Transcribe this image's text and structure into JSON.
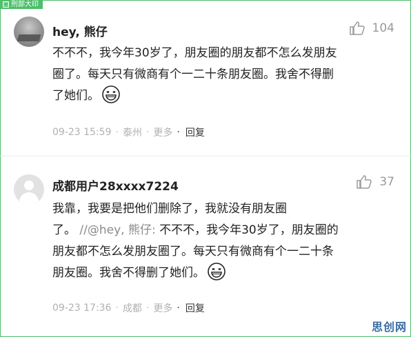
{
  "badge": {
    "label": "刑部大印",
    "icon": "stamp-icon"
  },
  "comments": [
    {
      "username": "hey, 熊仔",
      "likes": "104",
      "lines": [
        "不不不，我今年30岁了，朋友圈的朋友都不怎么发朋友",
        "圈了。每天只有微商有个一二十条朋友圈。我舍不得删",
        "了她们。"
      ],
      "time": "09-23 15:59",
      "location": "泰州",
      "more": "更多",
      "reply": "回复"
    },
    {
      "username": "成都用户28xxxx7224",
      "likes": "37",
      "line1": "我靠，我要是把他们删除了，我就没有朋友圈",
      "line2_plain": "了。",
      "quote_prefix": "//@hey, 熊仔:",
      "line2_rest": "不不不，我今年30岁了，朋友圈的",
      "line3": "朋友都不怎么发朋友圈了。每天只有微商有个一二十条",
      "line4": "朋友圈。我舍不得删了她们。",
      "time": "09-23 17:36",
      "location": "成都",
      "more": "更多",
      "reply": "回复"
    }
  ],
  "watermark": "思创网",
  "colors": {
    "frame": "#4dbf6a",
    "meta": "#b0b0b0",
    "watermark": "#3a6ea5"
  }
}
